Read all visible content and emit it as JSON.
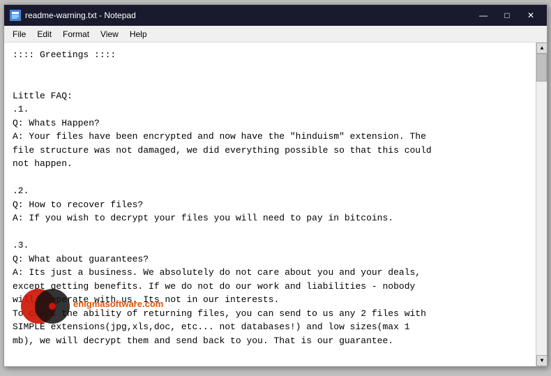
{
  "window": {
    "title": "readme-warning.txt - Notepad",
    "icon": "📄"
  },
  "controls": {
    "minimize": "—",
    "maximize": "□",
    "close": "✕"
  },
  "menu": {
    "items": [
      "File",
      "Edit",
      "Format",
      "View",
      "Help"
    ]
  },
  "content": {
    "text": ":::: Greetings ::::\n\n\nLittle FAQ:\n.1.\nQ: Whats Happen?\nA: Your files have been encrypted and now have the \"hinduism\" extension. The\nfile structure was not damaged, we did everything possible so that this could\nnot happen.\n\n.2.\nQ: How to recover files?\nA: If you wish to decrypt your files you will need to pay in bitcoins.\n\n.3.\nQ: What about guarantees?\nA: Its just a business. We absolutely do not care about you and your deals,\nexcept getting benefits. If we do not do our work and liabilities - nobody\nwill cooperate with us. Its not in our interests.\nTo check the ability of returning files, you can send to us any 2 files with\nSIMPLE extensions(jpg,xls,doc, etc... not databases!) and low sizes(max 1\nmb), we will decrypt them and send back to you. That is our guarantee."
  },
  "watermark": {
    "text": "enigmasoftware.com"
  }
}
